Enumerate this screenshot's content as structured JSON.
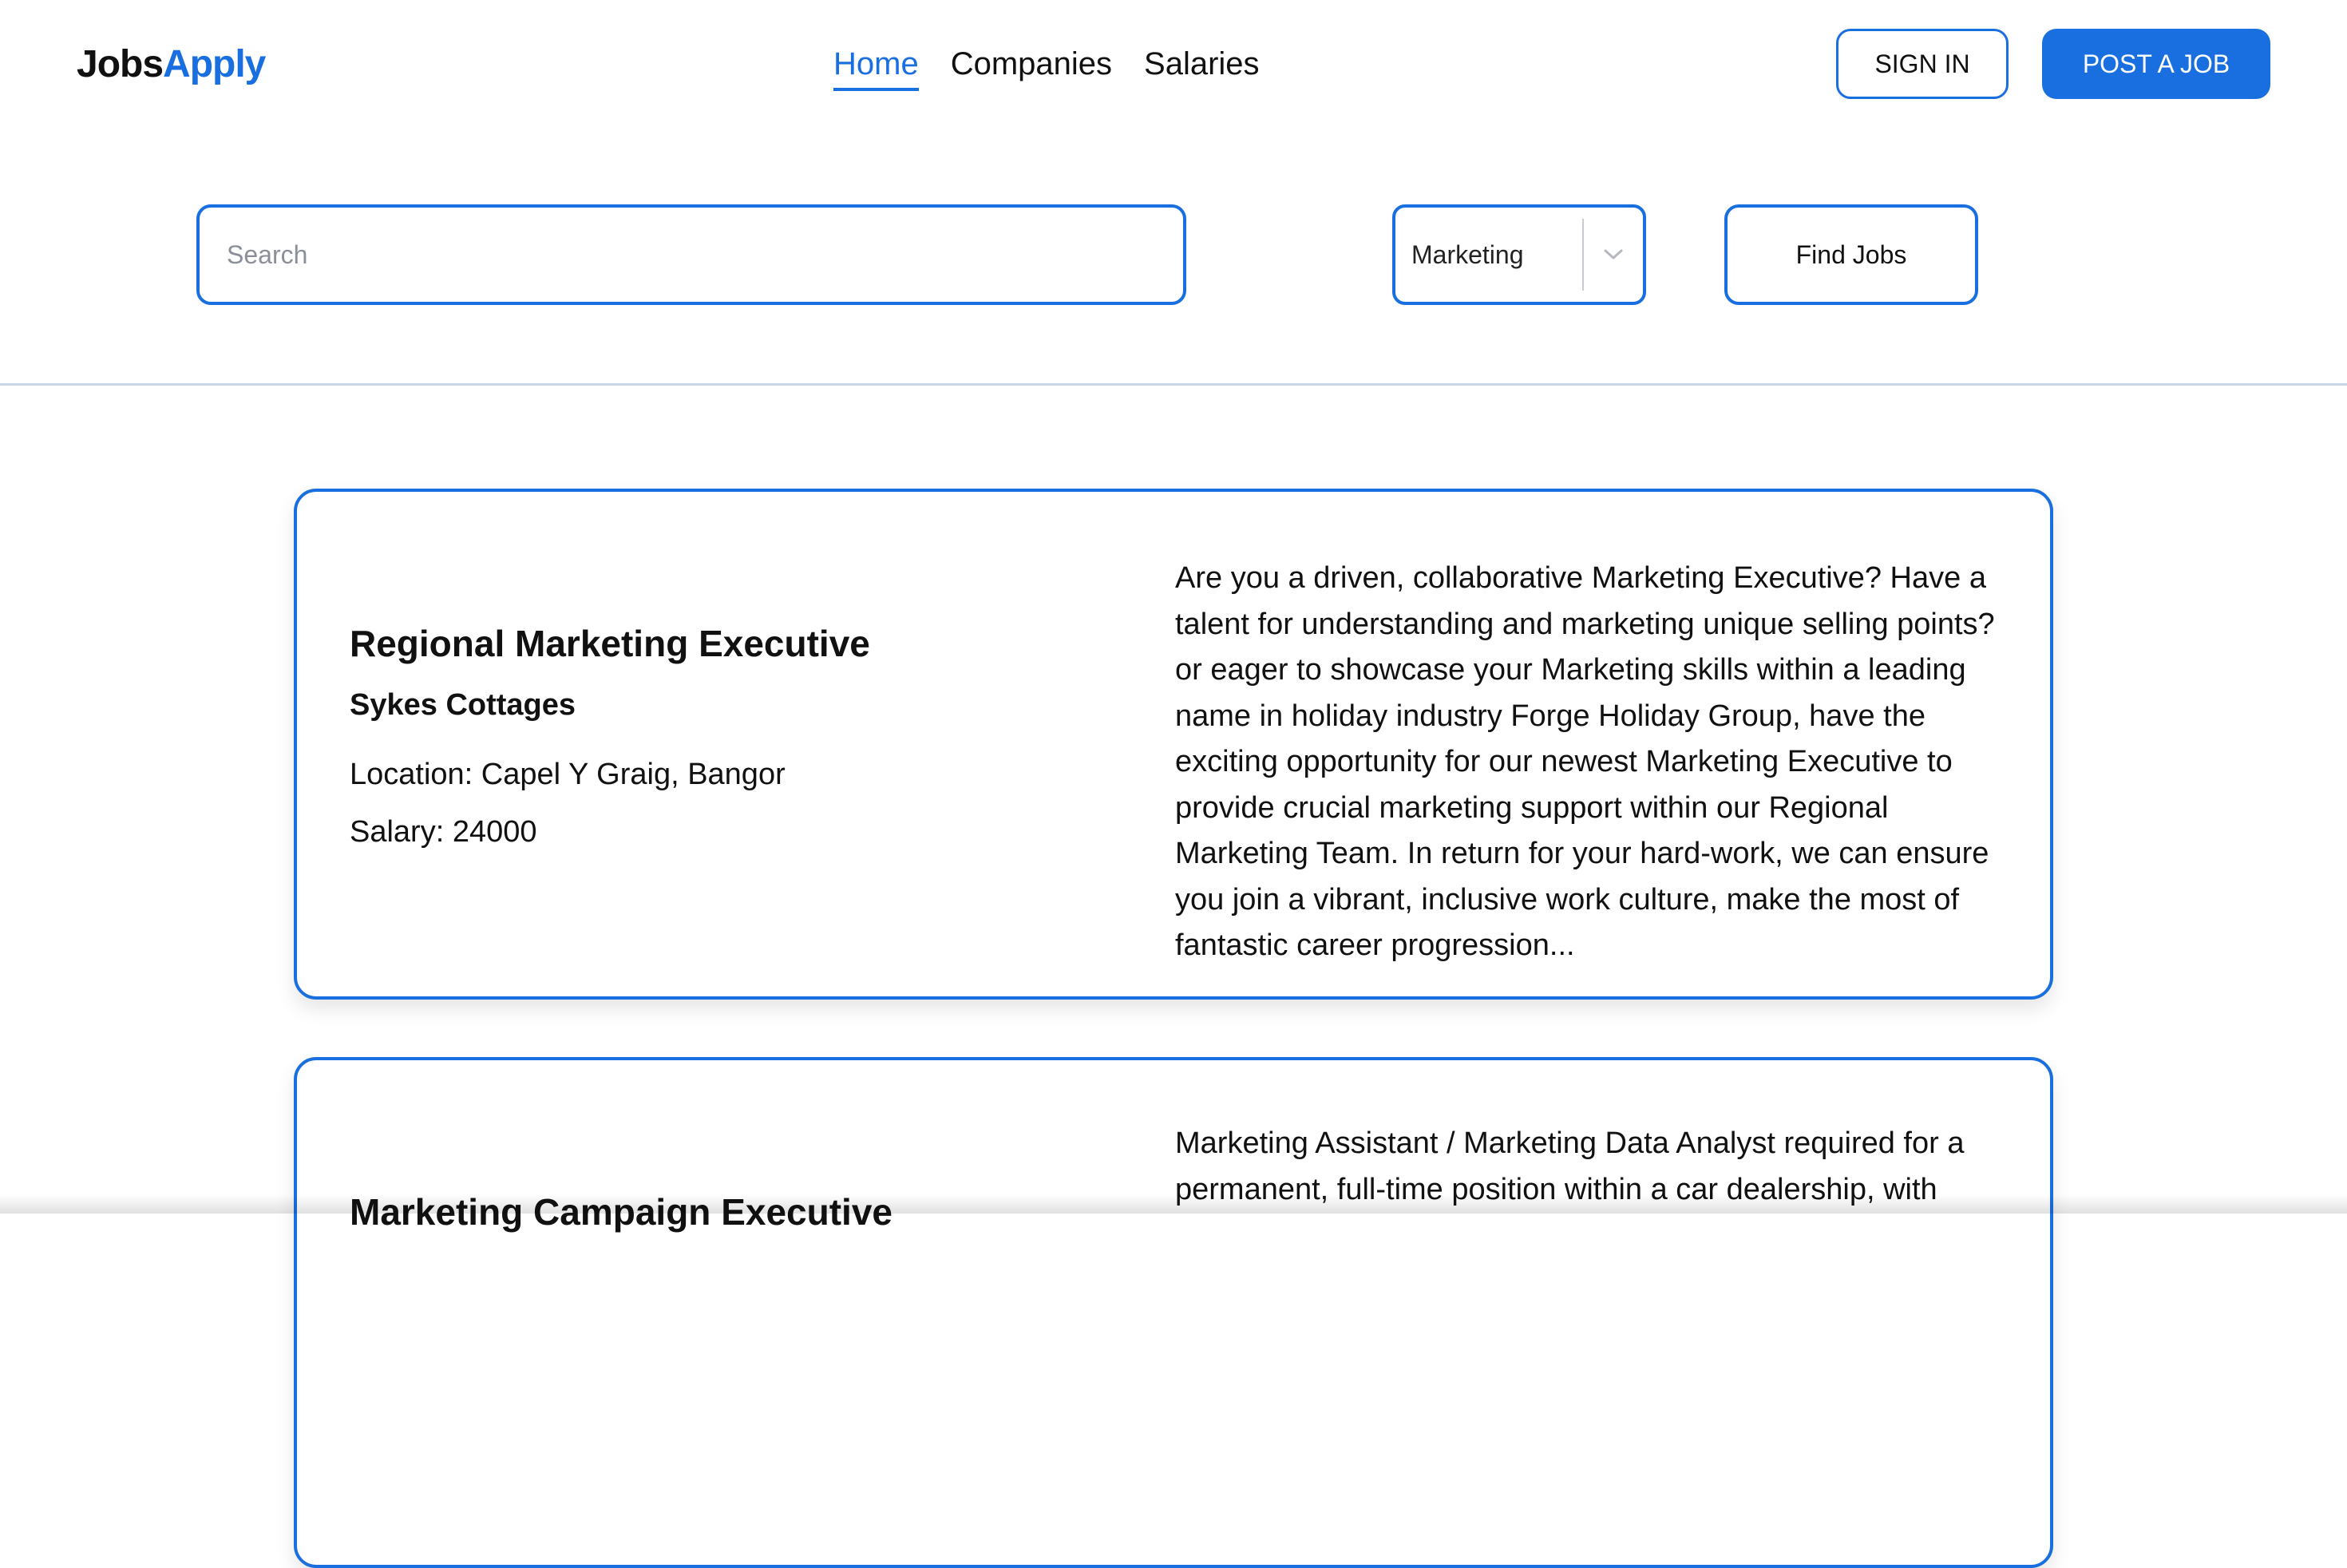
{
  "brand": {
    "part1": "Jobs",
    "part2": "Apply",
    "accent_color": "#1a6fe0"
  },
  "nav": {
    "items": [
      {
        "label": "Home",
        "active": true
      },
      {
        "label": "Companies",
        "active": false
      },
      {
        "label": "Salaries",
        "active": false
      }
    ]
  },
  "header": {
    "sign_in_label": "SIGN IN",
    "post_job_label": "POST A JOB"
  },
  "search": {
    "placeholder": "Search",
    "value": "",
    "category_selected": "Marketing",
    "find_label": "Find Jobs"
  },
  "jobs": [
    {
      "title": "Regional Marketing Executive",
      "company": "Sykes Cottages",
      "location": "Location: Capel Y Graig, Bangor",
      "salary": "Salary: 24000",
      "description": "Are you a driven, collaborative Marketing Executive? Have a talent for understanding and marketing unique selling points? or eager to showcase your Marketing skills within a leading name in holiday industry Forge Holiday Group, have the exciting opportunity for our newest Marketing Executive to provide crucial marketing support within our Regional Marketing Team. In return for your hard-work, we can ensure you join a vibrant, inclusive work culture, make the most of fantastic career progression..."
    },
    {
      "title": "Marketing Campaign Executive",
      "company": "",
      "location": "",
      "salary": "",
      "description": "Marketing Assistant / Marketing Data Analyst required for a permanent, full-time position within a car dealership, with"
    }
  ]
}
